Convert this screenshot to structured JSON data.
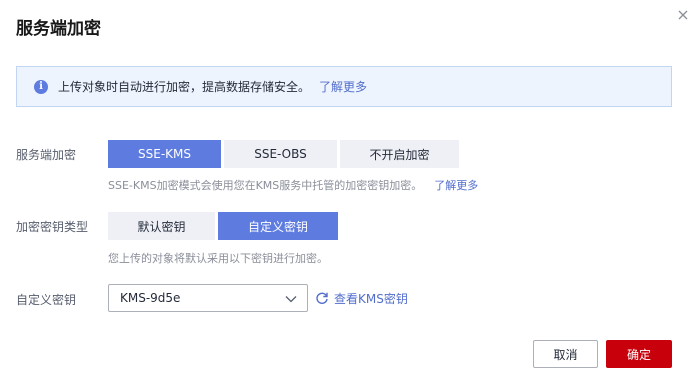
{
  "dialog": {
    "title": "服务端加密",
    "close_icon": "close-icon"
  },
  "banner": {
    "icon": "info-icon",
    "icon_glyph": "i",
    "text": "上传对象时自动进行加密，提高数据存储安全。",
    "link": "了解更多"
  },
  "encryption": {
    "label": "服务端加密",
    "options": [
      "SSE-KMS",
      "SSE-OBS",
      "不开启加密"
    ],
    "selected": "SSE-KMS",
    "hint": "SSE-KMS加密模式会使用您在KMS服务中托管的加密密钥加密。",
    "hint_link": "了解更多"
  },
  "key_type": {
    "label": "加密密钥类型",
    "options": [
      "默认密钥",
      "自定义密钥"
    ],
    "selected": "自定义密钥",
    "hint": "您上传的对象将默认采用以下密钥进行加密。"
  },
  "custom_key": {
    "label": "自定义密钥",
    "value": "KMS-9d5e",
    "refresh_icon": "refresh-icon",
    "view_link": "查看KMS密钥"
  },
  "footer": {
    "cancel": "取消",
    "confirm": "确定"
  },
  "colors": {
    "accent": "#5e7ce0",
    "link": "#526ecc",
    "primary_button": "#c7000b",
    "banner_bg": "#eef4fd",
    "segment_bg": "#eef0f5"
  }
}
